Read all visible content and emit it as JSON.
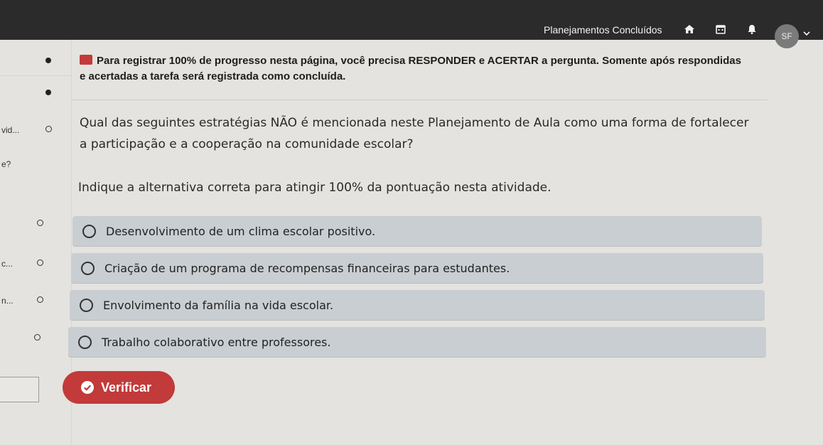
{
  "header": {
    "title": "Planejamentos Concluídos",
    "avatar_initials": "SF",
    "icons": [
      "home-icon",
      "calendar-icon",
      "bell-icon",
      "chevron-down-icon"
    ]
  },
  "sidebar": {
    "items": [
      {
        "label": "vid..."
      },
      {
        "label": "e?"
      },
      {
        "label": "c..."
      },
      {
        "label": "n..."
      }
    ]
  },
  "notice": {
    "text": "Para registrar 100% de progresso nesta página, você precisa RESPONDER e ACERTAR a pergunta. Somente após respondidas e acertadas a tarefa será registrada como concluída."
  },
  "question": {
    "text": "Qual das seguintes estratégias NÃO é mencionada neste Planejamento de Aula como uma forma de fortalecer a participação e a cooperação na comunidade escolar?",
    "instruction": "Indique a alternativa correta para atingir 100% da pontuação nesta atividade."
  },
  "options": [
    {
      "label": "Desenvolvimento de um clima escolar positivo."
    },
    {
      "label": "Criação de um programa de recompensas financeiras para estudantes."
    },
    {
      "label": "Envolvimento da família na vida escolar."
    },
    {
      "label": "Trabalho colaborativo entre professores."
    }
  ],
  "actions": {
    "verify_label": "Verificar"
  },
  "colors": {
    "navbar": "#2b2b2b",
    "option_bg": "#c9ced2",
    "verify_button": "#c23a3a",
    "page_bg": "#e4e3df"
  }
}
